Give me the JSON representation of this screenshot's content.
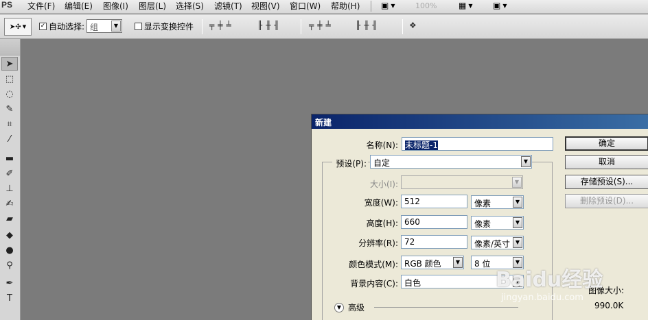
{
  "menubar": {
    "logo": "PS",
    "menus": [
      "文件(F)",
      "编辑(E)",
      "图像(I)",
      "图层(L)",
      "选择(S)",
      "滤镜(T)",
      "视图(V)",
      "窗口(W)",
      "帮助(H)"
    ],
    "zoom": "100%"
  },
  "options_bar": {
    "auto_select_label": "自动选择:",
    "auto_select_checked": true,
    "auto_select_value": "组",
    "show_transform_label": "显示变换控件",
    "show_transform_checked": false,
    "align_icons": [
      "align-top-icon",
      "align-vcenter-icon",
      "align-bottom-icon",
      "align-left-icon",
      "align-hcenter-icon",
      "align-right-icon",
      "distribute-top-icon",
      "distribute-vcenter-icon",
      "distribute-bottom-icon",
      "distribute-left-icon",
      "distribute-hcenter-icon",
      "distribute-right-icon",
      "auto-align-icon"
    ]
  },
  "tools": [
    "move-icon",
    "marquee-icon",
    "lasso-icon",
    "quick-select-icon",
    "crop-icon",
    "eyedropper-icon",
    "healing-brush-icon",
    "brush-icon",
    "stamp-icon",
    "history-brush-icon",
    "eraser-icon",
    "paint-bucket-icon",
    "blur-icon",
    "dodge-icon",
    "pen-icon",
    "text-icon"
  ],
  "dialog": {
    "title": "新建",
    "name_label": "名称(N):",
    "name_value": "未标题-1",
    "preset_label": "预设(P):",
    "preset_value": "自定",
    "size_label": "大小(I):",
    "size_value": "",
    "width_label": "宽度(W):",
    "width_value": "512",
    "width_unit": "像素",
    "height_label": "高度(H):",
    "height_value": "660",
    "height_unit": "像素",
    "resolution_label": "分辨率(R):",
    "resolution_value": "72",
    "resolution_unit": "像素/英寸",
    "color_mode_label": "颜色模式(M):",
    "color_mode_value": "RGB 颜色",
    "bit_depth_value": "8 位",
    "background_label": "背景内容(C):",
    "background_value": "白色",
    "advanced_label": "高级",
    "ok_label": "确定",
    "cancel_label": "取消",
    "save_preset_label": "存储预设(S)...",
    "delete_preset_label": "删除预设(D)...",
    "image_size_label": "图像大小:",
    "image_size_value": "990.0K"
  },
  "watermark": {
    "brand": "Baidu经验",
    "url": "jingyan.baidu.com"
  }
}
